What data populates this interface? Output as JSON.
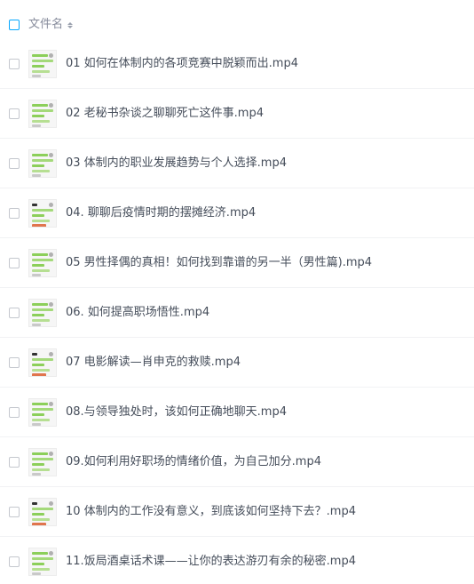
{
  "header": {
    "column_title": "文件名"
  },
  "files": [
    {
      "name": "01 如何在体制内的各项竞赛中脱颖而出.mp4",
      "thumb": "normal"
    },
    {
      "name": "02 老秘书杂谈之聊聊死亡这件事.mp4",
      "thumb": "normal"
    },
    {
      "name": "03 体制内的职业发展趋势与个人选择.mp4",
      "thumb": "normal"
    },
    {
      "name": "04. 聊聊后疫情时期的摆摊经济.mp4",
      "thumb": "variant"
    },
    {
      "name": "05 男性择偶的真相！如何找到靠谱的另一半（男性篇).mp4",
      "thumb": "normal"
    },
    {
      "name": "06. 如何提高职场悟性.mp4",
      "thumb": "normal"
    },
    {
      "name": "07 电影解读—肖申克的救赎.mp4",
      "thumb": "variant"
    },
    {
      "name": "08.与领导独处时，该如何正确地聊天.mp4",
      "thumb": "normal"
    },
    {
      "name": "09.如何利用好职场的情绪价值，为自己加分.mp4",
      "thumb": "normal"
    },
    {
      "name": "10 体制内的工作没有意义，到底该如何坚持下去？.mp4",
      "thumb": "variant"
    },
    {
      "name": "11.饭局酒桌话术课——让你的表达游刃有余的秘密.mp4",
      "thumb": "normal"
    }
  ]
}
